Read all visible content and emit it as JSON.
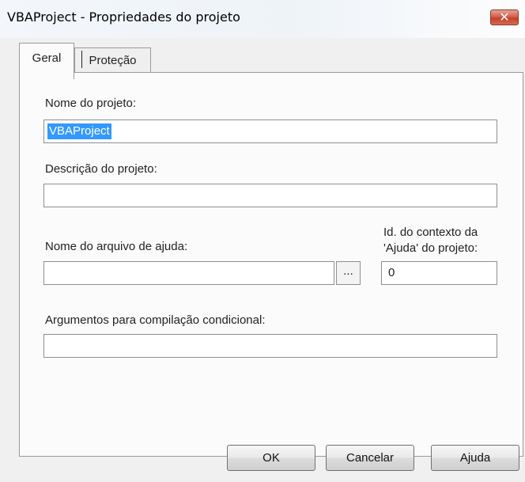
{
  "window": {
    "title": "VBAProject - Propriedades do projeto",
    "close_glyph": "✕"
  },
  "tabs": [
    {
      "label": "Geral",
      "selected": true
    },
    {
      "label": "Proteção",
      "selected": false
    }
  ],
  "form": {
    "project_name_label": "Nome do projeto:",
    "project_name_value": "VBAProject",
    "description_label": "Descrição do projeto:",
    "description_value": "",
    "help_file_label": "Nome do arquivo de ajuda:",
    "help_file_value": "",
    "browse_label": "...",
    "help_context_label_line1": "Id. do contexto da",
    "help_context_label_line2": "'Ajuda' do projeto:",
    "help_context_value": "0",
    "conditional_args_label": "Argumentos para compilação condicional:",
    "conditional_args_value": ""
  },
  "buttons": {
    "ok": "OK",
    "cancel": "Cancelar",
    "help": "Ajuda"
  },
  "colors": {
    "selection": "#3399ff",
    "close_button": "#c2402a"
  }
}
